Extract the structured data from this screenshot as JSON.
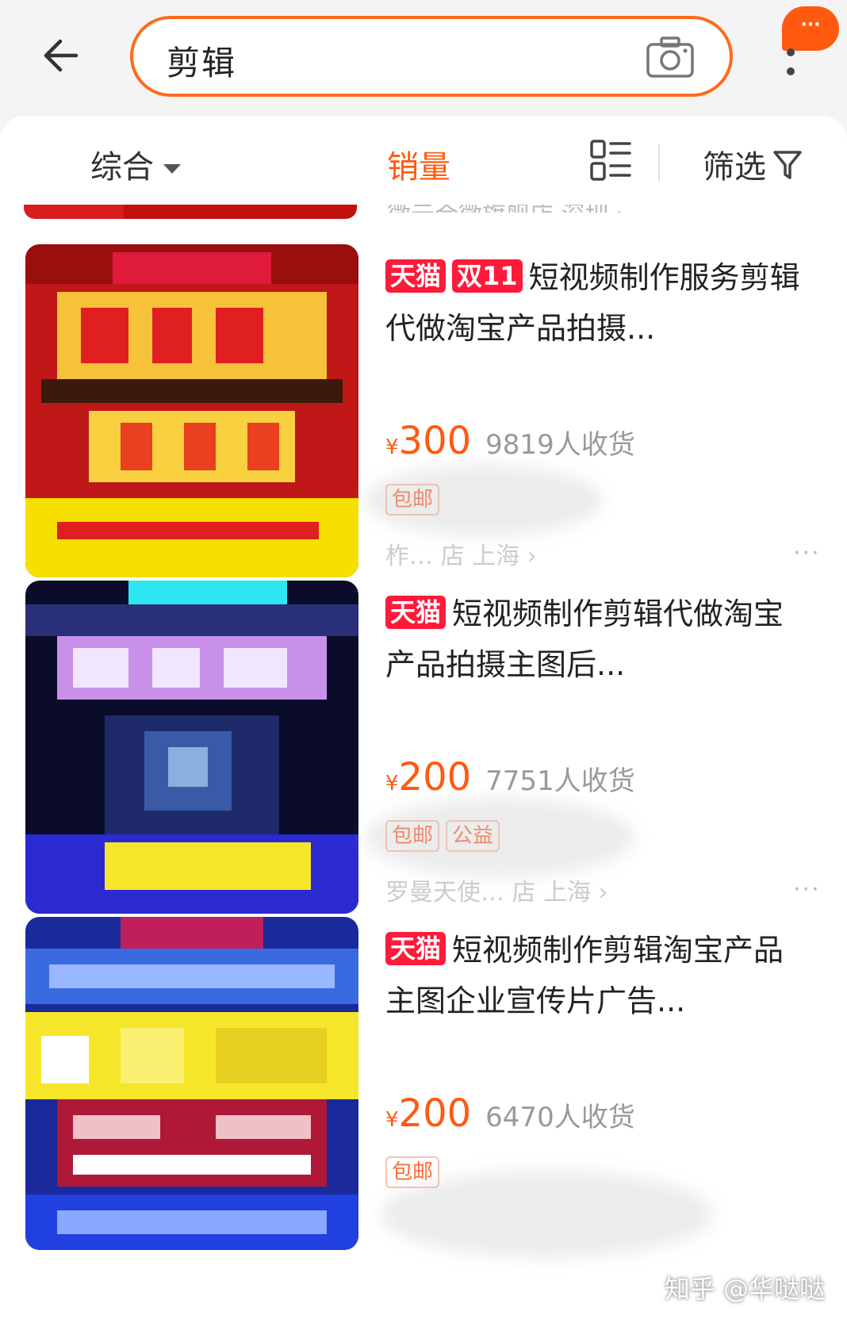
{
  "header": {
    "search_value": "剪辑",
    "notify_badge": "···"
  },
  "sort_bar": {
    "comprehensive": "综合",
    "sales": "销量",
    "filter": "筛选"
  },
  "remnant_text": "微元合微旗舰店 深圳 ›",
  "products": [
    {
      "tags": [
        "天猫",
        "双11"
      ],
      "title": "短视频制作服务剪辑代做淘宝产品拍摄...",
      "currency": "¥",
      "price": "300",
      "sold": "9819人收货",
      "badges": [
        "包邮"
      ],
      "shop": "柞… 店 上海 ›"
    },
    {
      "tags": [
        "天猫"
      ],
      "title": "短视频制作剪辑代做淘宝产品拍摄主图后...",
      "currency": "¥",
      "price": "200",
      "sold": "7751人收货",
      "badges": [
        "包邮",
        "公益"
      ],
      "shop": "罗曼天使… 店 上海 ›"
    },
    {
      "tags": [
        "天猫"
      ],
      "title": "短视频制作剪辑淘宝产品主图企业宣传片广告...",
      "currency": "¥",
      "price": "200",
      "sold": "6470人收货",
      "badges": [
        "包邮"
      ],
      "shop": ""
    }
  ],
  "more_dots": "···",
  "watermark": "知乎 @华哒哒",
  "colors": {
    "accent": "#ff5a10",
    "tmall_red": "#ff1a3a"
  }
}
